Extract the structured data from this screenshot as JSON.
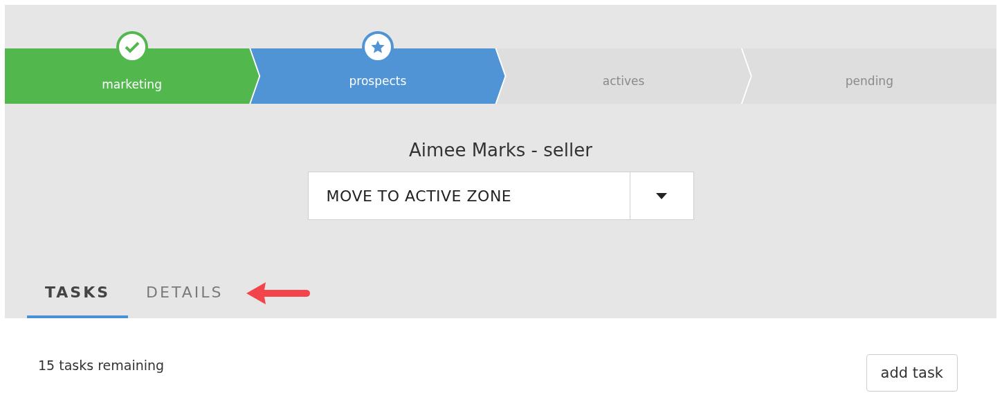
{
  "stepper": {
    "steps": [
      {
        "label": "marketing",
        "kind": "done"
      },
      {
        "label": "prospects",
        "kind": "current"
      },
      {
        "label": "actives",
        "kind": "upcoming"
      },
      {
        "label": "pending",
        "kind": "upcoming"
      }
    ]
  },
  "contact": {
    "title": "Aimee Marks - seller",
    "action": "MOVE TO ACTIVE ZONE"
  },
  "tabs": [
    {
      "label": "TASKS",
      "selected": true
    },
    {
      "label": "DETAILS",
      "selected": false
    }
  ],
  "tasks": {
    "remaining": "15 tasks remaining",
    "add_button": "add task"
  }
}
